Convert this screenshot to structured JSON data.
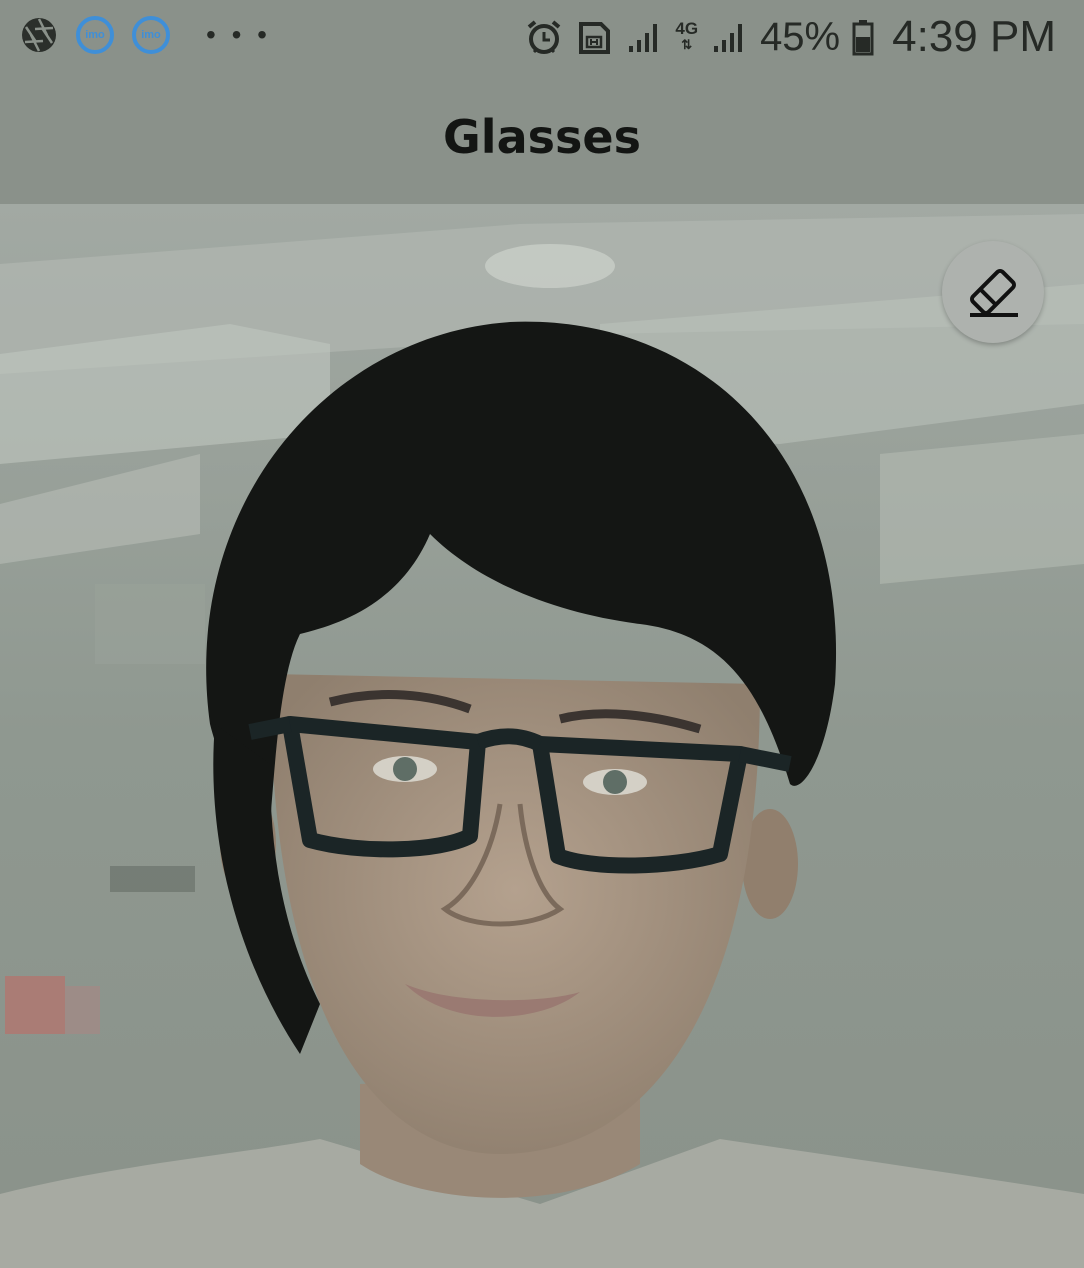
{
  "status_bar": {
    "left_icons": [
      "aperture-icon",
      "imo-icon",
      "imo-icon"
    ],
    "imo_label": "imo",
    "overflow": "• • •",
    "network": "4G",
    "battery_percent": "45%",
    "time": "4:39 PM"
  },
  "header": {
    "title": "Glasses"
  },
  "toolbar": {
    "eraser_icon": "eraser-icon"
  },
  "photo": {
    "subject": "portrait with glasses"
  }
}
